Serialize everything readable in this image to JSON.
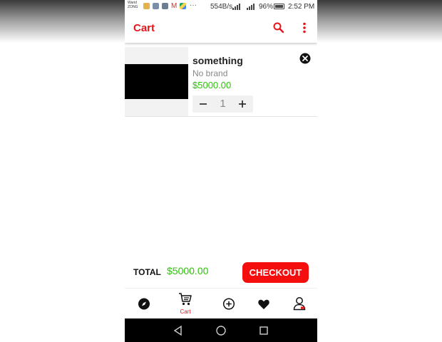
{
  "status_bar": {
    "carrier": "Warid ZONG",
    "net_speed": "554B/s",
    "network_1": "4G",
    "network_2": "2G",
    "battery_percent": "96%",
    "battery_level": 0.96,
    "time": "2:52 PM",
    "more_indicator": "···"
  },
  "app_bar": {
    "title": "Cart",
    "icons": [
      "search-icon",
      "overflow-menu-icon"
    ]
  },
  "cart": {
    "items": [
      {
        "name": "something",
        "brand": "No brand",
        "price": "$5000.00",
        "quantity": "1",
        "minus_label": "−",
        "plus_label": "+"
      }
    ]
  },
  "summary": {
    "total_label": "TOTAL",
    "total_value": "$5000.00",
    "checkout_label": "CHECKOUT"
  },
  "bottom_nav": {
    "items": [
      {
        "icon": "compass-icon",
        "label": ""
      },
      {
        "icon": "cart-icon",
        "label": "Cart",
        "active": true
      },
      {
        "icon": "add-circle-icon",
        "label": ""
      },
      {
        "icon": "heart-icon",
        "label": ""
      },
      {
        "icon": "user-icon",
        "label": ""
      }
    ]
  },
  "colors": {
    "accent": "#e8141b",
    "checkout": "#f50e0e",
    "price": "#2ec20b",
    "system_nav": "#000000"
  }
}
